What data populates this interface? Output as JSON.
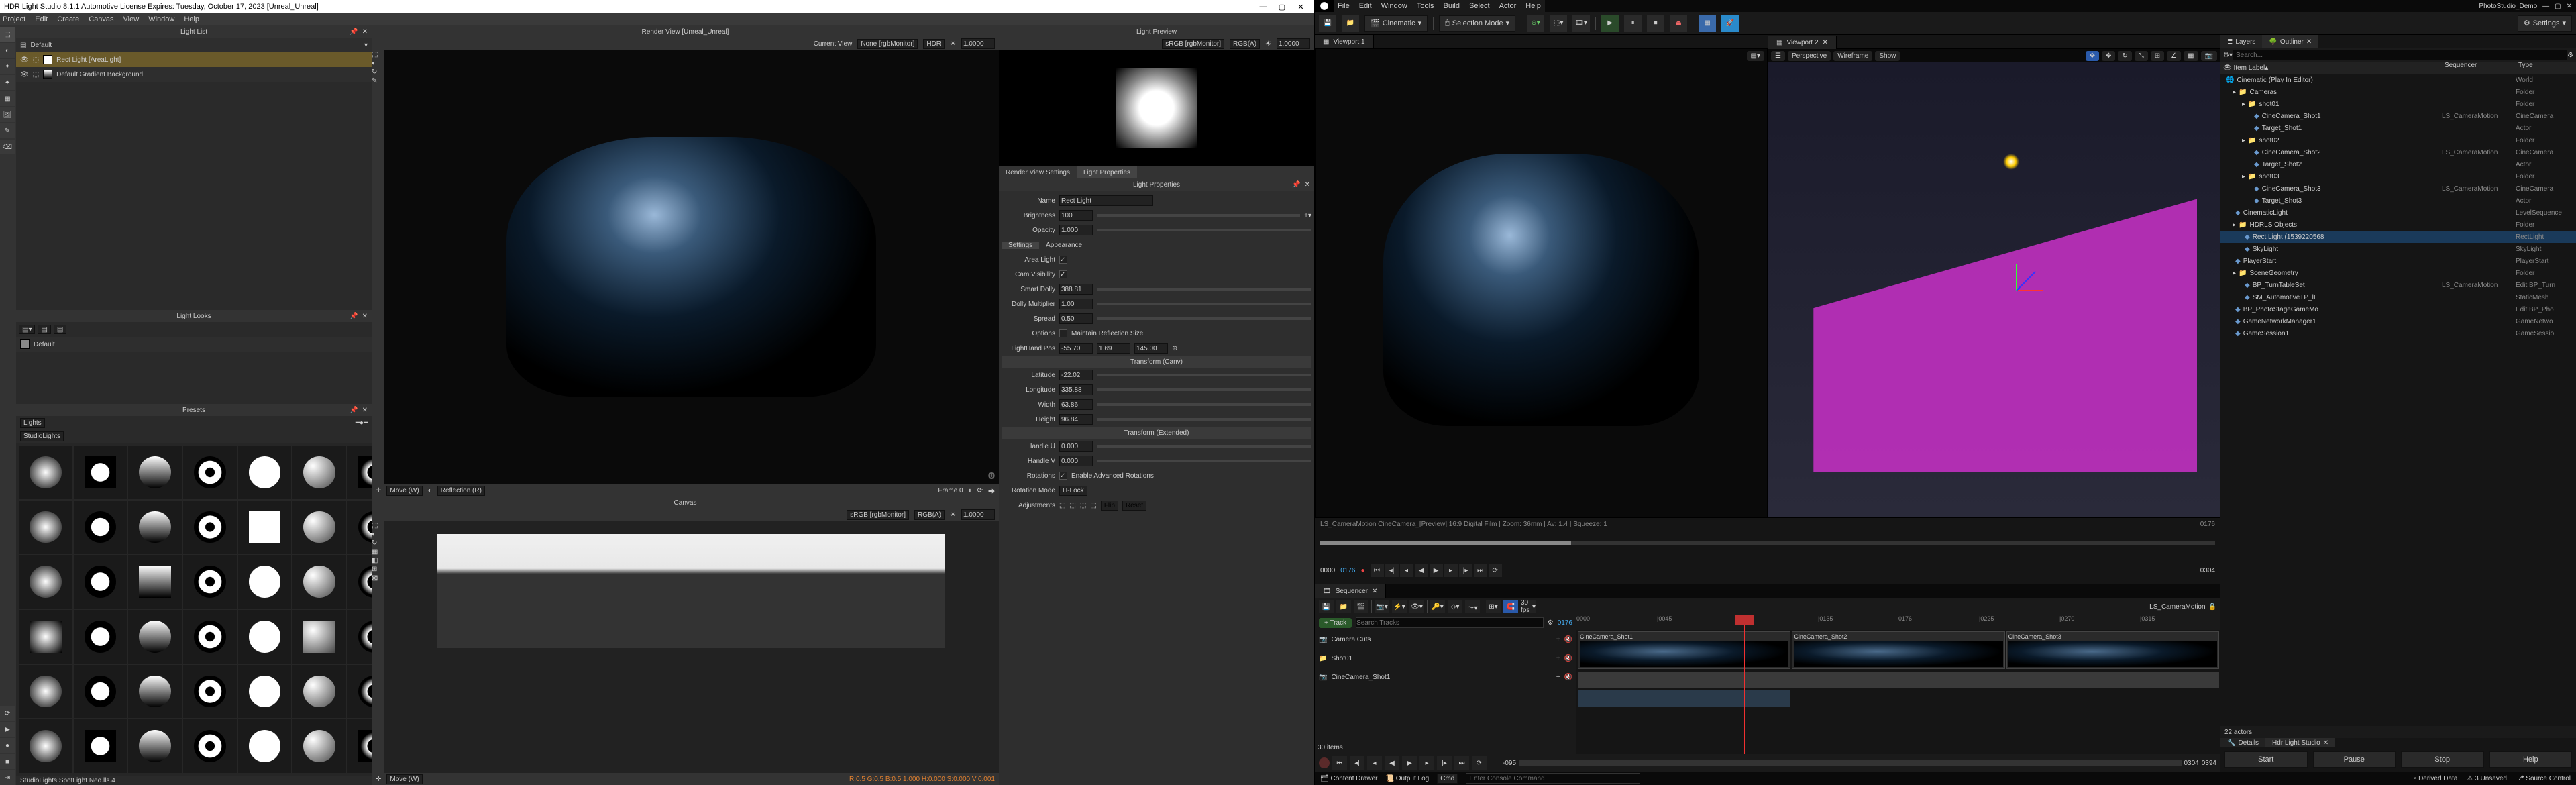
{
  "hdrls": {
    "titlebar": "HDR Light Studio 8.1.1   Automotive License Expires: Tuesday, October 17, 2023   [Unreal_Unreal]",
    "menu": [
      "Project",
      "Edit",
      "Create",
      "Canvas",
      "View",
      "Window",
      "Help"
    ],
    "lightlist": {
      "title": "Light List",
      "default_label": "Default",
      "rows": [
        {
          "name": "Rect Light [AreaLight]",
          "sel": true
        },
        {
          "name": "Default Gradient Background",
          "sel": false
        }
      ]
    },
    "lightlooks": {
      "title": "Light Looks",
      "default_label": "Default"
    },
    "presets": {
      "title": "Presets",
      "filter_lights": "Lights",
      "filter_studio": "StudioLights"
    },
    "status": "StudioLights SpotLight Neo.lls.4",
    "render": {
      "title": "Render View [Unreal_Unreal]",
      "current_view": "Current View",
      "current_view_val": "None [rgbMonitor]",
      "hdr": "HDR",
      "exposure": "1.0000",
      "move_label": "Move (W)",
      "reflect_label": "Reflection (R)",
      "frame_label": "Frame  0"
    },
    "canvas": {
      "title": "Canvas",
      "bar_srgb": "sRGB [rgbMonitor]",
      "bar_rgba": "RGB(A)",
      "exposure": "1.0000",
      "status_move": "Move (W)",
      "status_vals": "R:0.5 G:0.5 B:0.5   1.000   H:0.000 S:0.000 V:0.001"
    },
    "lightpreview": {
      "title": "Light Preview",
      "srgb": "sRGB [rgbMonitor]",
      "rgba": "RGB(A)",
      "exposure": "1.0000"
    },
    "proptabs": {
      "render": "Render View Settings",
      "light": "Light Properties"
    },
    "props": {
      "header": "Light Properties",
      "name_label": "Name",
      "name_val": "Rect Light",
      "brightness_label": "Brightness",
      "brightness_val": "100",
      "opacity_label": "Opacity",
      "opacity_val": "1.000",
      "settings_tab": "Settings",
      "appearance_tab": "Appearance",
      "arealight_label": "Area Light",
      "camvis_label": "Cam Visibility",
      "smartdolly_label": "Smart Dolly",
      "smartdolly_val": "388.81",
      "dollymult_label": "Dolly Multiplier",
      "dollymult_val": "1.00",
      "spread_label": "Spread",
      "spread_val": "0.50",
      "options_label": "Options",
      "options_check": "Maintain Reflection Size",
      "handpos_label": "LightHand Pos",
      "handpos_x": "-55.70",
      "handpos_y": "1.69",
      "handpos_z": "145.00",
      "tcanv": "Transform (Canv)",
      "lat_label": "Latitude",
      "lat_val": "-22.02",
      "lon_label": "Longitude",
      "lon_val": "335.88",
      "width_label": "Width",
      "width_val": "63.86",
      "height_label": "Height",
      "height_val": "96.84",
      "text": "Transform (Extended)",
      "handleu_label": "Handle U",
      "handleu_val": "0.000",
      "handlev_label": "Handle V",
      "handlev_val": "0.000",
      "rot_label": "Rotations",
      "rot_check": "Enable Advanced Rotations",
      "rotmode_label": "Rotation Mode",
      "rotmode_val": "H-Lock",
      "adj_label": "Adjustments",
      "flip_btn": "Flip",
      "reset_btn": "Reset"
    }
  },
  "ue": {
    "project": "PhotoStudio_Demo",
    "menu": [
      "File",
      "Edit",
      "Window",
      "Tools",
      "Build",
      "Select",
      "Actor",
      "Help"
    ],
    "toolbar": {
      "cinematic": "Cinematic",
      "mode": "Selection Mode",
      "settings": "Settings"
    },
    "viewports": {
      "tab1": "Viewport 1",
      "tab2": "Viewport 2",
      "persp": "Perspective",
      "wire": "Wireframe",
      "show": "Show",
      "info": "LS_CameraMotion CineCamera_[Preview]   16:9 Digital Film | Zoom: 36mm | Av: 1.4 | Squeeze: 1",
      "frame_start": "0000",
      "frame_cur": "0176",
      "frame_end": "0304"
    },
    "layers_tab": "Layers",
    "outliner_tab": "Outliner",
    "sequencer_tab": "Sequencer",
    "outliner": {
      "search_ph": "Search...",
      "col1": "Item Label",
      "col2": "Sequencer",
      "col3": "Type",
      "rows": [
        {
          "d": 0,
          "icon": "world",
          "name": "Cinematic (Play In Editor)",
          "c2": "",
          "c3": "World"
        },
        {
          "d": 1,
          "icon": "folder",
          "name": "Cameras",
          "c2": "",
          "c3": "Folder"
        },
        {
          "d": 2,
          "icon": "folder",
          "name": "shot01",
          "c2": "",
          "c3": "Folder"
        },
        {
          "d": 3,
          "icon": "actor",
          "name": "CineCamera_Shot1",
          "c2": "LS_CameraMotion",
          "c3": "CineCamera"
        },
        {
          "d": 3,
          "icon": "actor",
          "name": "Target_Shot1",
          "c2": "",
          "c3": "Actor"
        },
        {
          "d": 2,
          "icon": "folder",
          "name": "shot02",
          "c2": "",
          "c3": "Folder"
        },
        {
          "d": 3,
          "icon": "actor",
          "name": "CineCamera_Shot2",
          "c2": "LS_CameraMotion",
          "c3": "CineCamera"
        },
        {
          "d": 3,
          "icon": "actor",
          "name": "Target_Shot2",
          "c2": "",
          "c3": "Actor"
        },
        {
          "d": 2,
          "icon": "folder",
          "name": "shot03",
          "c2": "",
          "c3": "Folder"
        },
        {
          "d": 3,
          "icon": "actor",
          "name": "CineCamera_Shot3",
          "c2": "LS_CameraMotion",
          "c3": "CineCamera"
        },
        {
          "d": 3,
          "icon": "actor",
          "name": "Target_Shot3",
          "c2": "",
          "c3": "Actor"
        },
        {
          "d": 1,
          "icon": "actor",
          "name": "CinematicLight",
          "c2": "",
          "c3": "LevelSequence"
        },
        {
          "d": 1,
          "icon": "folder",
          "name": "HDRLS Objects",
          "c2": "",
          "c3": "Folder"
        },
        {
          "d": 2,
          "icon": "actor",
          "name": "Rect Light (1539220568",
          "c2": "",
          "c3": "RectLight",
          "sel": true
        },
        {
          "d": 2,
          "icon": "actor",
          "name": "SkyLight",
          "c2": "",
          "c3": "SkyLight"
        },
        {
          "d": 1,
          "icon": "actor",
          "name": "PlayerStart",
          "c2": "",
          "c3": "PlayerStart"
        },
        {
          "d": 1,
          "icon": "folder",
          "name": "SceneGeometry",
          "c2": "",
          "c3": "Folder"
        },
        {
          "d": 2,
          "icon": "actor",
          "name": "BP_TurnTableSet",
          "c2": "LS_CameraMotion",
          "c3": "Edit BP_Turn"
        },
        {
          "d": 2,
          "icon": "actor",
          "name": "SM_AutomotiveTP_lI",
          "c2": "",
          "c3": "StaticMesh"
        },
        {
          "d": 1,
          "icon": "actor",
          "name": "BP_PhotoStageGameMo",
          "c2": "",
          "c3": "Edit BP_Pho"
        },
        {
          "d": 1,
          "icon": "actor",
          "name": "GameNetworkManager1",
          "c2": "",
          "c3": "GameNetwo"
        },
        {
          "d": 1,
          "icon": "actor",
          "name": "GameSession1",
          "c2": "",
          "c3": "GameSessio"
        }
      ],
      "footer": "22 actors"
    },
    "details": {
      "tab": "Details",
      "hdrtab": "Hdr Light Studio",
      "start": "Start",
      "pause": "Pause",
      "stop": "Stop",
      "help": "Help"
    },
    "sequencer": {
      "name": "LS_CameraMotion",
      "track": "Track",
      "search_ph": "Search Tracks",
      "fps": "30 fps",
      "cur": "0176",
      "items_footer": "30 items",
      "ruler": [
        "0000",
        "|0045",
        "|0090",
        "|0135",
        "0176",
        "|0225",
        "|0270",
        "|0315"
      ],
      "shots": [
        "CineCamera_Shot1",
        "CineCamera_Shot2",
        "CineCamera_Shot3"
      ],
      "rows": [
        {
          "name": "Camera Cuts",
          "icon": "camera"
        },
        {
          "name": "Shot01",
          "icon": "folder"
        },
        {
          "name": "CineCamera_Shot1",
          "icon": "camera"
        }
      ],
      "range_start": "-095",
      "range_end": "0304",
      "range_end2": "0304",
      "range_end3": "0394"
    },
    "status": {
      "drawer": "Content Drawer",
      "output": "Output Log",
      "cmd": "Cmd",
      "cmd_ph": "Enter Console Command",
      "derived": "Derived Data",
      "unsaved": "3 Unsaved",
      "source": "Source Control"
    }
  }
}
